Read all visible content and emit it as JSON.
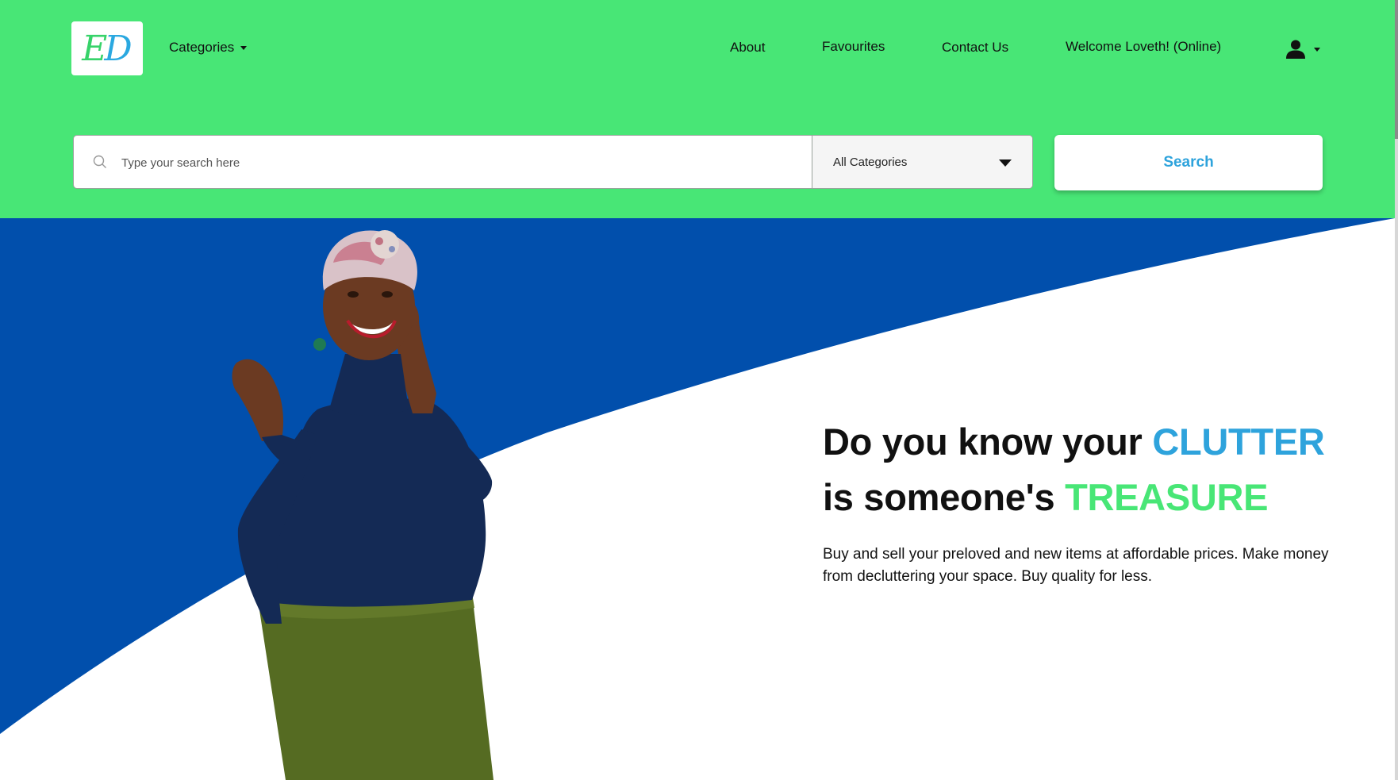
{
  "colors": {
    "header_green": "#48e676",
    "hero_blue": "#014fac",
    "accent_blue": "#2ea3dc",
    "accent_green": "#48e676"
  },
  "logo": {
    "text_e": "E",
    "text_d": "D"
  },
  "nav": {
    "categories_label": "Categories",
    "about_label": "About",
    "favourites_label": "Favourites",
    "contact_label": "Contact Us",
    "welcome_text": "Welcome Loveth! (Online)",
    "user_icon": "user-icon"
  },
  "search": {
    "placeholder": "Type your search here",
    "category_selected": "All Categories",
    "button_label": "Search"
  },
  "hero": {
    "headline_part1": "Do you know your ",
    "headline_highlight1": "CLUTTER",
    "headline_part2": "is someone's ",
    "headline_highlight2": "TREASURE",
    "subtext": "Buy and sell your preloved and new items at affordable prices. Make money from decluttering your space. Buy quality for less."
  }
}
